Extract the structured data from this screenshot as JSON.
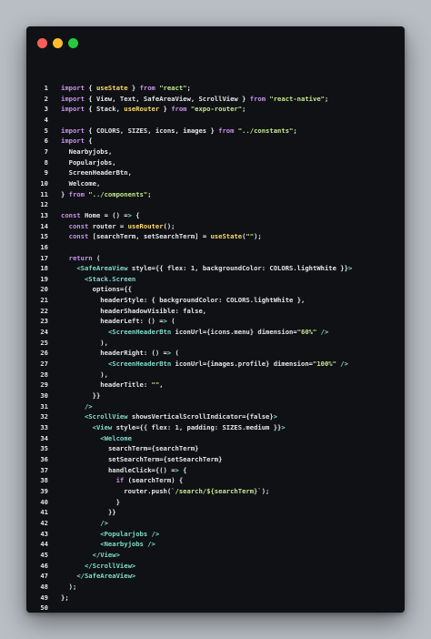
{
  "window": {
    "controls": [
      "close",
      "minimize",
      "maximize"
    ]
  },
  "code_lines": [
    {
      "n": "1",
      "text": "import { useState } from \"react\";"
    },
    {
      "n": "2",
      "text": "import { View, Text, SafeAreaView, ScrollView } from \"react-native\";"
    },
    {
      "n": "3",
      "text": "import { Stack, useRouter } from \"expo-router\";"
    },
    {
      "n": "4",
      "text": ""
    },
    {
      "n": "5",
      "text": "import { COLORS, SIZES, icons, images } from \"../constants\";"
    },
    {
      "n": "6",
      "text": "import {"
    },
    {
      "n": "7",
      "text": "  Nearbyjobs,"
    },
    {
      "n": "8",
      "text": "  Popularjobs,"
    },
    {
      "n": "9",
      "text": "  ScreenHeaderBtn,"
    },
    {
      "n": "10",
      "text": "  Welcome,"
    },
    {
      "n": "11",
      "text": "} from \"../components\";"
    },
    {
      "n": "12",
      "text": ""
    },
    {
      "n": "13",
      "text": "const Home = () => {"
    },
    {
      "n": "14",
      "text": "  const router = useRouter();"
    },
    {
      "n": "15",
      "text": "  const [searchTerm, setSearchTerm] = useState(\"\");"
    },
    {
      "n": "16",
      "text": ""
    },
    {
      "n": "17",
      "text": "  return ("
    },
    {
      "n": "18",
      "text": "    <SafeAreaView style={{ flex: 1, backgroundColor: COLORS.lightWhite }}>"
    },
    {
      "n": "19",
      "text": "      <Stack.Screen"
    },
    {
      "n": "20",
      "text": "        options={{"
    },
    {
      "n": "21",
      "text": "          headerStyle: { backgroundColor: COLORS.lightWhite },"
    },
    {
      "n": "22",
      "text": "          headerShadowVisible: false,"
    },
    {
      "n": "23",
      "text": "          headerLeft: () => ("
    },
    {
      "n": "24",
      "text": "            <ScreenHeaderBtn iconUrl={icons.menu} dimension=\"60%\" />"
    },
    {
      "n": "25",
      "text": "          ),"
    },
    {
      "n": "26",
      "text": "          headerRight: () => ("
    },
    {
      "n": "27",
      "text": "            <ScreenHeaderBtn iconUrl={images.profile} dimension=\"100%\" />"
    },
    {
      "n": "28",
      "text": "          ),"
    },
    {
      "n": "29",
      "text": "          headerTitle: \"\","
    },
    {
      "n": "30",
      "text": "        }}"
    },
    {
      "n": "31",
      "text": "      />"
    },
    {
      "n": "32",
      "text": "      <ScrollView showsVerticalScrollIndicator={false}>"
    },
    {
      "n": "33",
      "text": "        <View style={{ flex: 1, padding: SIZES.medium }}>"
    },
    {
      "n": "34",
      "text": "          <Welcome"
    },
    {
      "n": "35",
      "text": "            searchTerm={searchTerm}"
    },
    {
      "n": "36",
      "text": "            setSearchTerm={setSearchTerm}"
    },
    {
      "n": "37",
      "text": "            handleClick={() => {"
    },
    {
      "n": "38",
      "text": "              if (searchTerm) {"
    },
    {
      "n": "39",
      "text": "                router.push(`/search/${searchTerm}`);"
    },
    {
      "n": "40",
      "text": "              }"
    },
    {
      "n": "41",
      "text": "            }}"
    },
    {
      "n": "42",
      "text": "          />"
    },
    {
      "n": "43",
      "text": "          <Popularjobs />"
    },
    {
      "n": "44",
      "text": "          <Nearbyjobs />"
    },
    {
      "n": "45",
      "text": "        </View>"
    },
    {
      "n": "46",
      "text": "      </ScrollView>"
    },
    {
      "n": "47",
      "text": "    </SafeAreaView>"
    },
    {
      "n": "48",
      "text": "  );"
    },
    {
      "n": "49",
      "text": "};"
    },
    {
      "n": "50",
      "text": ""
    },
    {
      "n": "51",
      "text": "export default Home;"
    }
  ],
  "colors": {
    "background": "#b9bec4",
    "editor_bg": "#0f1115",
    "keyword": "#c792ea",
    "string": "#c3e88d",
    "function": "#ffd966",
    "jsx_tag": "#7fdbca",
    "plain": "#e6e6e6"
  }
}
